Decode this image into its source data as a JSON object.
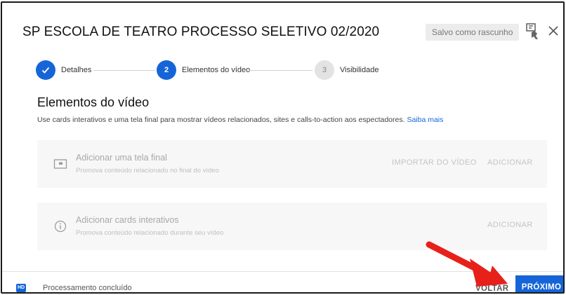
{
  "header": {
    "title": "SP ESCOLA DE TEATRO PROCESSO SELETIVO 02/2020",
    "draft_status": "Salvo como rascunho"
  },
  "stepper": {
    "steps": [
      {
        "number": "",
        "label": "Detalhes",
        "state": "done"
      },
      {
        "number": "2",
        "label": "Elementos do vídeo",
        "state": "active"
      },
      {
        "number": "3",
        "label": "Visibilidade",
        "state": "todo"
      }
    ]
  },
  "main": {
    "title": "Elementos do vídeo",
    "description": "Use cards interativos e uma tela final para mostrar vídeos relacionados, sites e calls-to-action aos espectadores.",
    "learn_more": "Saiba mais",
    "cards": [
      {
        "icon": "end-screen-icon",
        "title": "Adicionar uma tela final",
        "subtitle": "Promova conteúdo relacionado no final do vídeo",
        "import_label": "IMPORTAR DO VÍDEO",
        "add_label": "ADICIONAR"
      },
      {
        "icon": "info-icon",
        "title": "Adicionar cards interativos",
        "subtitle": "Promova conteúdo relacionado durante seu vídeo",
        "add_label": "ADICIONAR"
      }
    ]
  },
  "footer": {
    "hd_badge": "HD",
    "processing_status": "Processamento concluído",
    "back_label": "VOLTAR",
    "next_label": "PRÓXIMO"
  },
  "colors": {
    "accent": "#1565d8",
    "annotation_arrow": "#e8201a"
  }
}
